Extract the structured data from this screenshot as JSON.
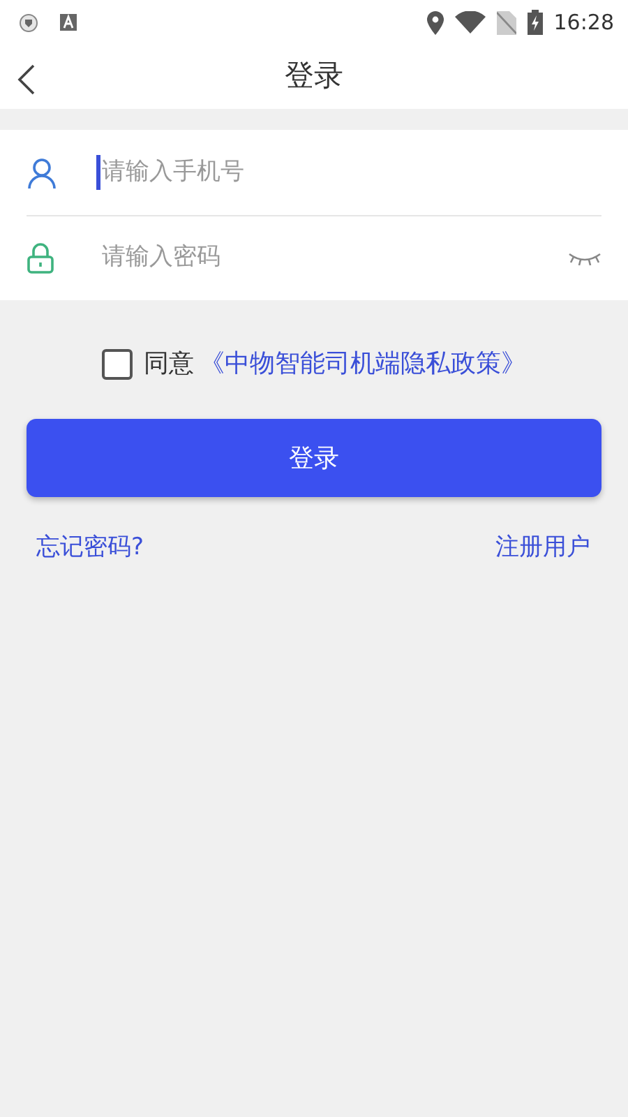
{
  "status_bar": {
    "time": "16:28"
  },
  "header": {
    "title": "登录"
  },
  "fields": [
    {
      "kind": "phone",
      "placeholder": "请输入手机号",
      "focused": true
    },
    {
      "kind": "password",
      "placeholder": "请输入密码",
      "focused": false,
      "password_visible": false
    }
  ],
  "agreement": {
    "checked": false,
    "prefix": "同意",
    "link": "《中物智能司机端隐私政策》"
  },
  "login_button": "登录",
  "links": {
    "forgot": "忘记密码?",
    "register": "注册用户"
  }
}
